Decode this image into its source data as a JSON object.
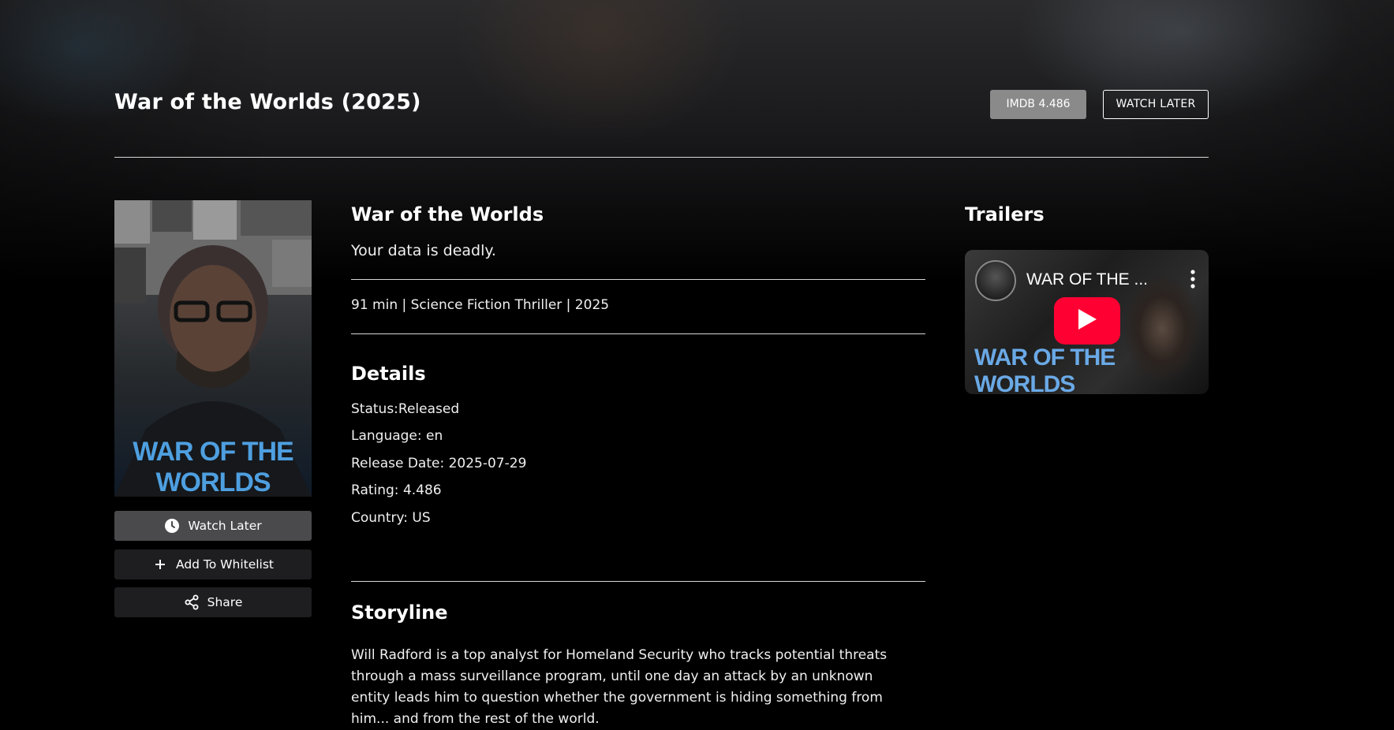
{
  "header": {
    "title": "War of the Worlds (2025)",
    "imdb_badge": "IMDB 4.486",
    "watch_later": "WATCH LATER"
  },
  "poster": {
    "title_text": "WAR OF THE WORLDS"
  },
  "actions": {
    "watch_later": {
      "label": "Watch Later",
      "icon": "clock-icon"
    },
    "add_to_whitelist": {
      "label": "Add To Whitelist",
      "icon": "plus-icon"
    },
    "share": {
      "label": "Share",
      "icon": "share-icon"
    }
  },
  "movie": {
    "name": "War of the Worlds",
    "tagline": "Your data is deadly.",
    "meta": "91 min | Science Fiction Thriller | 2025"
  },
  "details": {
    "heading": "Details",
    "status": "Status:Released",
    "language": "Language: en",
    "release_date": "Release Date: 2025-07-29",
    "rating": "Rating: 4.486",
    "country": "Country: US"
  },
  "storyline": {
    "heading": "Storyline",
    "text": "Will Radford is a top analyst for Homeland Security who tracks potential threats through a mass surveillance program, until one day an attack by an unknown entity leads him to question whether the government is hiding something from him... and from the rest of the world."
  },
  "trailers": {
    "heading": "Trailers",
    "video_title": "WAR OF THE ...",
    "video_logo": "WAR OF THE WORLDS"
  },
  "colors": {
    "background": "#000000",
    "imdb_badge": "#8a8a8a",
    "play_button": "#ff0033",
    "poster_title": "#4e9fe0"
  }
}
